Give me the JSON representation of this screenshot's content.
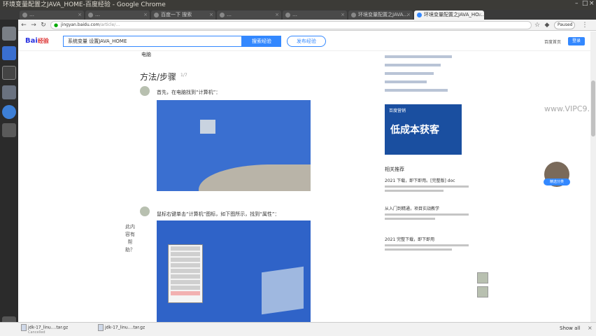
{
  "window": {
    "title": "环境变量配置之JAVA_HOME-百度经验 - Google Chrome"
  },
  "tabs": [
    {
      "label": "…"
    },
    {
      "label": "…"
    },
    {
      "label": "百度一下 搜索"
    },
    {
      "label": "…"
    },
    {
      "label": "…"
    },
    {
      "label": "环境变量配置之JAVA…"
    },
    {
      "label": "环境变量配置之JAVA_HO…",
      "active": true
    }
  ],
  "toolbar": {
    "url_host": "jingyan.baidu.com",
    "url_path": "/article/…",
    "paused_label": "Paused"
  },
  "header": {
    "logo": "Bai",
    "logo_suffix": "经验",
    "search_value": "系统变量 设置JAVA_HOME",
    "search_button": "搜索经验",
    "post_button": "发布经验",
    "home_link": "百度首页",
    "login_button": "登录"
  },
  "article": {
    "computer_label": "电脑",
    "section_title": "方法/步骤",
    "section_sub": "1/7",
    "step1_text": "首先，在电脑找到“计算机”：",
    "step2_text": "鼠标右键单击“计算机”图标，如下图所示，找到“属性”："
  },
  "sidebar": {
    "ad_top": "百度营销",
    "ad_main": "低成本获客",
    "related_title": "相关推荐",
    "related": [
      {
        "title": "2021 下载，即下即用。[完整版] doc"
      },
      {
        "title": "从入门到精通，项目实战教学"
      },
      {
        "title": "2021 完整下载，即下即用"
      }
    ]
  },
  "watermark": "www.VIPC9…",
  "float_widget": {
    "label": "精选分类"
  },
  "feedback": {
    "text": "此内容有帮助？"
  },
  "downloads": {
    "items": [
      {
        "name": "jdk-17_linu....tar.gz",
        "status": "Cancelled"
      },
      {
        "name": "jdk-17_linu....tar.gz",
        "status": ""
      }
    ],
    "show_all": "Show all"
  },
  "colors": {
    "accent": "#3388ff",
    "launcher": "#2b2b2b"
  }
}
